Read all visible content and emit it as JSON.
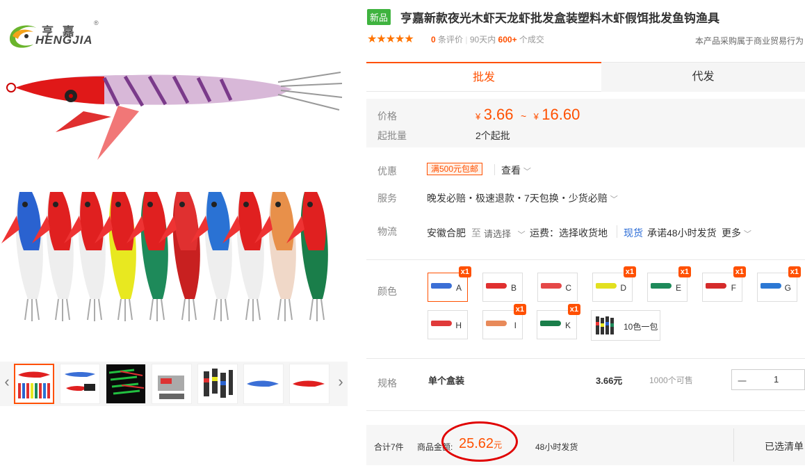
{
  "brand": {
    "cn": "亨 嘉",
    "en": "HENGJIA",
    "reg": "®"
  },
  "gallery": {
    "prev_icon": "‹",
    "next_icon": "›"
  },
  "product": {
    "badge": "新品",
    "title": "亨嘉新款夜光木虾天龙虾批发盒装塑料木虾假饵批发鱼钩渔具",
    "stars": "★★★★★",
    "review_count": "0",
    "review_label": "条评价",
    "days_label": "90天内",
    "deals": "600+",
    "deals_label": "个成交",
    "trade_note": "本产品采购属于商业贸易行为"
  },
  "tabs": [
    "批发",
    "代发"
  ],
  "price": {
    "label": "价格",
    "currency": "¥",
    "low": "3.66",
    "tilde": "~",
    "high": "16.60",
    "moq_label": "起批量",
    "moq": "2个起批"
  },
  "promo": {
    "label": "优惠",
    "tag": "满500元包邮",
    "view": "查看"
  },
  "service": {
    "label": "服务",
    "text": "晚发必赔・极速退款・7天包换・少货必赔"
  },
  "logistics": {
    "label": "物流",
    "from": "安徽合肥",
    "to": "至",
    "select": "请选择",
    "fee": "运费：选择收货地",
    "stock": "现货",
    "promise": "承诺48小时发货",
    "more": "更多"
  },
  "colors": {
    "label": "颜色",
    "items": [
      {
        "code": "A",
        "count": "x1",
        "selected": true,
        "hue": "#3b6fd6"
      },
      {
        "code": "B",
        "count": "",
        "selected": false,
        "hue": "#e03030"
      },
      {
        "code": "C",
        "count": "",
        "selected": false,
        "hue": "#e54848"
      },
      {
        "code": "D",
        "count": "x1",
        "selected": false,
        "hue": "#e2e020"
      },
      {
        "code": "E",
        "count": "x1",
        "selected": false,
        "hue": "#1e8a5a"
      },
      {
        "code": "F",
        "count": "x1",
        "selected": false,
        "hue": "#d52b2b"
      },
      {
        "code": "G",
        "count": "x1",
        "selected": false,
        "hue": "#2c78d4"
      },
      {
        "code": "H",
        "count": "",
        "selected": false,
        "hue": "#e03a3a"
      },
      {
        "code": "I",
        "count": "x1",
        "selected": false,
        "hue": "#e88a5a"
      },
      {
        "code": "K",
        "count": "x1",
        "selected": false,
        "hue": "#1a7e4a"
      }
    ],
    "bundle": "10色一包"
  },
  "spec": {
    "label": "规格",
    "name": "单个盒装",
    "price": "3.66元",
    "stock": "1000个可售",
    "minus": "一",
    "qty": "1"
  },
  "footer": {
    "total_count": "合计7件",
    "amount_label": "商品金额:",
    "amount": "25.62",
    "unit": "元",
    "ship": "48小时发货",
    "selected": "已选清单"
  }
}
